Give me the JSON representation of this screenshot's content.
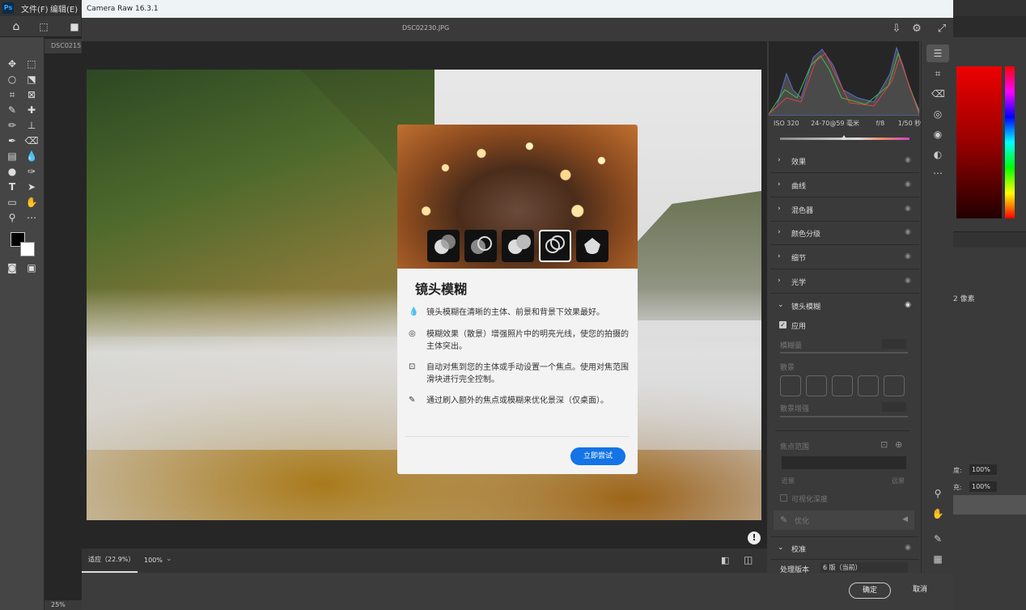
{
  "photoshop": {
    "menu": [
      "文件(F)",
      "编辑(E)"
    ],
    "doc_tab": "DSC0215",
    "status_zoom": "25%",
    "right_panel": {
      "unit": "2 像素",
      "opacity1": "100%",
      "opacity2": "100%",
      "label_fill": "充:",
      "label_opacity": "度:"
    }
  },
  "camera_raw": {
    "window_title": "Camera Raw 16.3.1",
    "filename": "DSC02230.JPG",
    "exif": {
      "iso": "ISO 320",
      "lens": "24-70@59 毫米",
      "aperture": "f/8",
      "shutter": "1/50 秒"
    },
    "zoom_fit": "适应（22.9%）",
    "zoom_100": "100%",
    "sections": [
      {
        "label": "效果"
      },
      {
        "label": "曲线"
      },
      {
        "label": "混色器"
      },
      {
        "label": "颜色分级"
      },
      {
        "label": "细节"
      },
      {
        "label": "光学"
      },
      {
        "label": "镜头模糊"
      }
    ],
    "lens_blur": {
      "apply": "应用",
      "blur_amount": "模糊量",
      "bokeh": "散景",
      "boost": "散景增强",
      "focus_range": "焦点范围",
      "near": "近景",
      "far": "远景",
      "visualize_depth": "可视化深度",
      "refine": "优化"
    },
    "calibration": {
      "label": "校准",
      "process_version_label": "处理版本",
      "process_version_value": "6 版（当前）"
    },
    "ok": "确定",
    "cancel": "取消"
  },
  "popup": {
    "title": "镜头模糊",
    "features": [
      {
        "icon": "droplet-icon",
        "text": "镜头模糊在清晰的主体、前景和背景下效果最好。"
      },
      {
        "icon": "bokeh-icon",
        "text": "模糊效果（散景）增强照片中的明亮光线，使您的拍摄的主体突出。"
      },
      {
        "icon": "focus-subject-icon",
        "text": "自动对焦到您的主体或手动设置一个焦点。使用对焦范围滑块进行完全控制。"
      },
      {
        "icon": "brush-icon",
        "text": "通过刷入额外的焦点或模糊来优化景深（仅桌面）。"
      }
    ],
    "try_button": "立即尝试"
  },
  "colors": {
    "accent": "#1473e6",
    "dialog_bg": "#3c3c3c",
    "popup_bg": "#f3f3f3"
  }
}
